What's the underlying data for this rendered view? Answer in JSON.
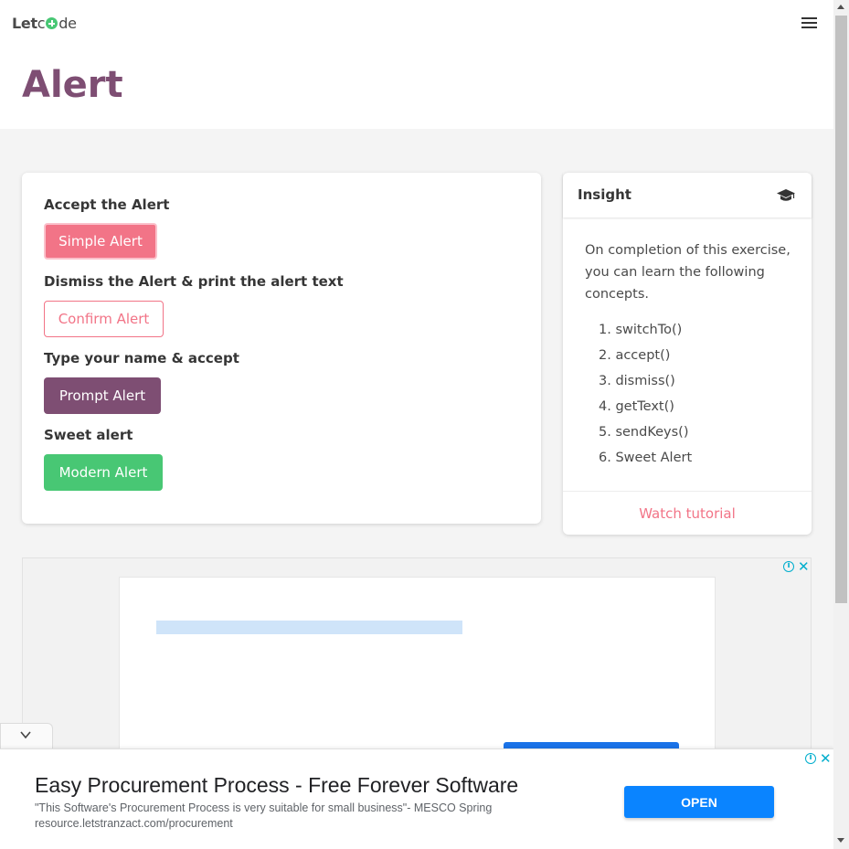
{
  "navbar": {
    "logo_prefix": "Let",
    "logo_suffix": "de",
    "logo_mark_icon": "plus-circle-icon",
    "menu_icon": "hamburger-menu-icon"
  },
  "hero": {
    "title": "Alert"
  },
  "alerts": {
    "accept_label": "Accept the Alert",
    "simple_button": "Simple Alert",
    "dismiss_label": "Dismiss the Alert & print the alert text",
    "confirm_button": "Confirm Alert",
    "type_label": "Type your name & accept",
    "prompt_button": "Prompt Alert",
    "sweet_label": "Sweet alert",
    "modern_button": "Modern Alert"
  },
  "insight": {
    "title": "Insight",
    "icon": "graduation-cap-icon",
    "text": "On completion of this exercise, you can learn the following concepts.",
    "concepts": [
      "1. switchTo()",
      "2. accept()",
      "3. dismiss()",
      "4. getText()",
      "5. sendKeys()",
      "6. Sweet Alert"
    ],
    "watch_link": "Watch tutorial"
  },
  "bottom_ad": {
    "title": "Easy Procurement Process - Free Forever Software",
    "description": "\"This Software's Procurement Process is very suitable for small business\"- MESCO Spring",
    "url": "resource.letstranzact.com/procurement",
    "open_button": "OPEN"
  },
  "colors": {
    "brand": "#7e4e73",
    "pink": "#f27487",
    "green": "#48c774",
    "ad_blue": "#0a84ff"
  }
}
